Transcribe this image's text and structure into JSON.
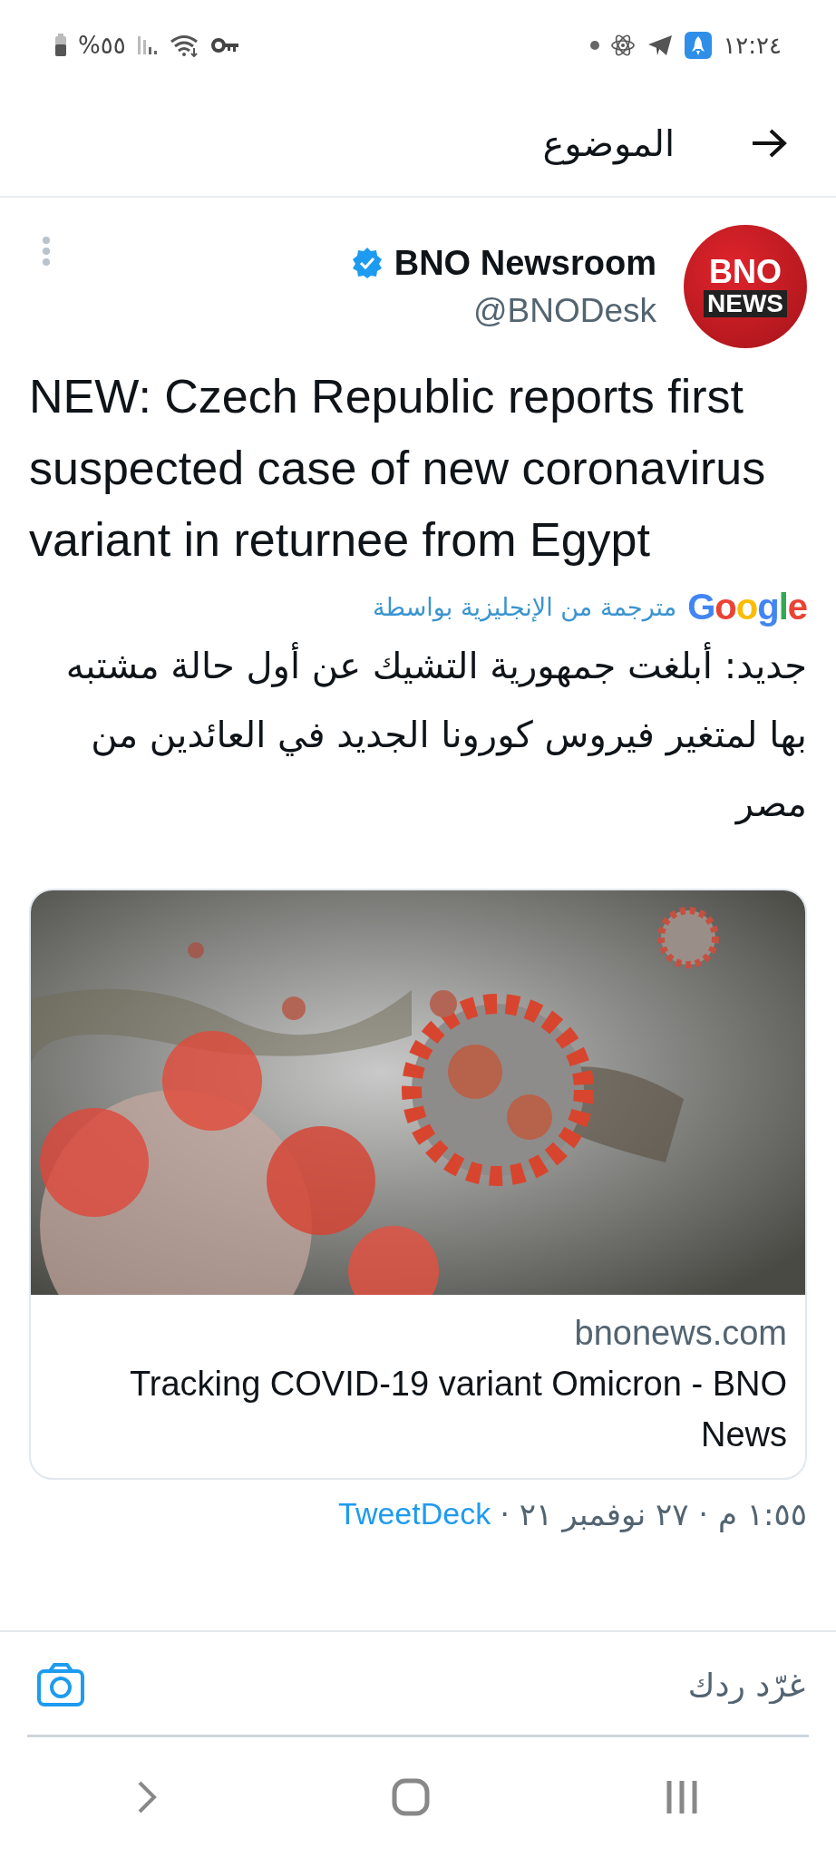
{
  "status_bar": {
    "time": "١٢:٢٤",
    "battery": "%٥٥"
  },
  "header": {
    "title": "الموضوع"
  },
  "tweet": {
    "author": {
      "name": "BNO Newsroom",
      "handle": "@BNODesk",
      "verified": true,
      "avatar_lines": [
        "BNO",
        "NEWS"
      ]
    },
    "text": "NEW: Czech Republic reports first suspected case of new coronavirus variant in returnee from Egypt",
    "translation": {
      "label": "مترجمة من الإنجليزية بواسطة",
      "provider": "Google",
      "text": "جديد: أبلغت جمهورية التشيك عن أول حالة مشتبه بها لمتغير فيروس كورونا الجديد في العائدين من مصر"
    },
    "card": {
      "domain": "bnonews.com",
      "title": "Tracking COVID-19 variant Omicron - BNO News"
    },
    "meta": {
      "time": "١:٥٥ م · ٢٧ نوفمبر ٢١ ·",
      "source": "TweetDeck"
    }
  },
  "compose": {
    "placeholder": "غرّد ردك"
  }
}
